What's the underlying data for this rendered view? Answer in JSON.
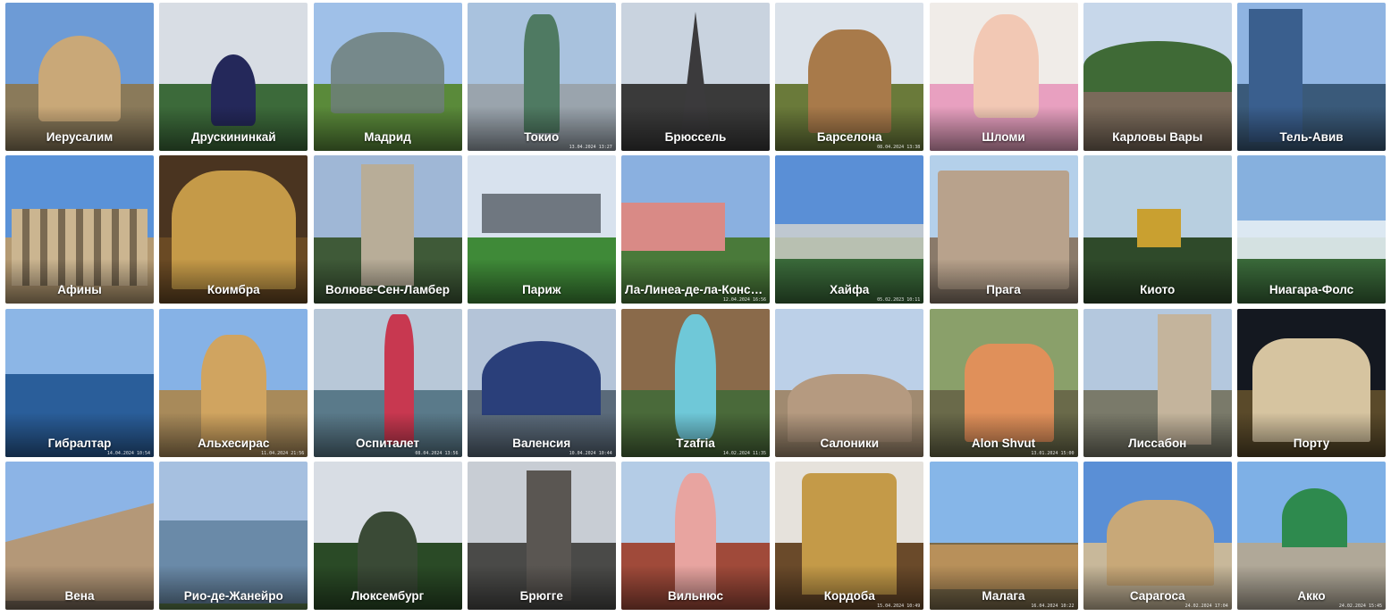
{
  "albums": [
    {
      "label": "Иерусалим",
      "sky": "#6d9bd6",
      "ground": "#8a7a5a",
      "shape": "#c9a878",
      "kind": "dome"
    },
    {
      "label": "Друскининкай",
      "sky": "#d8dde4",
      "ground": "#3c6a3a",
      "shape": "#24285a",
      "kind": "onion"
    },
    {
      "label": "Мадрид",
      "sky": "#9fc0e8",
      "ground": "#5a8a3a",
      "shape": "#6f7f7a",
      "kind": "glass"
    },
    {
      "label": "Токио",
      "sky": "#a9c2de",
      "ground": "#9aa4ad",
      "shape": "#4f7a62",
      "kind": "statue",
      "stamp": "13.04.2024 13:27"
    },
    {
      "label": "Брюссель",
      "sky": "#c9d3df",
      "ground": "#3a3a3a",
      "shape": "#3b3a3c",
      "kind": "spire"
    },
    {
      "label": "Барселона",
      "sky": "#dbe2ea",
      "ground": "#6a7a3a",
      "shape": "#a87a4a",
      "kind": "tower",
      "stamp": "08.04.2024 13:38"
    },
    {
      "label": "Шломи",
      "sky": "#f0ece8",
      "ground": "#e8a0c0",
      "shape": "#f2c8b4",
      "kind": "person"
    },
    {
      "label": "Карловы Вары",
      "sky": "#c7d7ea",
      "ground": "#7a6a5a",
      "shape": "#3f6a36",
      "kind": "town"
    },
    {
      "label": "Тель-Авив",
      "sky": "#8fb4e2",
      "ground": "#3a5a7a",
      "shape": "#3a5f8e",
      "kind": "skyscraper"
    },
    {
      "label": "Афины",
      "sky": "#5a92d8",
      "ground": "#b49a72",
      "shape": "#cbb590",
      "kind": "columns"
    },
    {
      "label": "Коимбра",
      "sky": "#4a3420",
      "ground": "#6a4a24",
      "shape": "#c59a48",
      "kind": "library"
    },
    {
      "label": "Волюве-Сен-Ламбер",
      "sky": "#9fb7d6",
      "ground": "#3f5a38",
      "shape": "#b8ad98",
      "kind": "gothic"
    },
    {
      "label": "Париж",
      "sky": "#d8e2ee",
      "ground": "#3f8a38",
      "shape": "#6f7780",
      "kind": "palace"
    },
    {
      "label": "Ла-Линеа-де-ла-Консепсьон",
      "sky": "#8ab0e0",
      "ground": "#4a7a3a",
      "shape": "#d98a86",
      "kind": "sculpture",
      "stamp": "12.04.2024 16:56"
    },
    {
      "label": "Хайфа",
      "sky": "#5a8fd6",
      "ground": "#3a6a3a",
      "shape": "#d8d6d0",
      "kind": "city",
      "stamp": "05.02.2023 10:11"
    },
    {
      "label": "Прага",
      "sky": "#b4d0ea",
      "ground": "#8a7a6a",
      "shape": "#b8a28c",
      "kind": "station"
    },
    {
      "label": "Киото",
      "sky": "#b8cfe0",
      "ground": "#2f4a2a",
      "shape": "#c9a030",
      "kind": "pavilion"
    },
    {
      "label": "Ниагара-Фолс",
      "sky": "#86b0de",
      "ground": "#3a6a3a",
      "shape": "#e6eef4",
      "kind": "falls"
    },
    {
      "label": "Гибралтар",
      "sky": "#8cb6e6",
      "ground": "#1f4f8a",
      "shape": "#2a5e9a",
      "kind": "sea",
      "stamp": "14.04.2024 10:54"
    },
    {
      "label": "Альхесирас",
      "sky": "#86b2e6",
      "ground": "#a88a5a",
      "shape": "#d0a460",
      "kind": "church",
      "stamp": "11.04.2024 21:56"
    },
    {
      "label": "Оспиталет",
      "sky": "#b8c8d8",
      "ground": "#5a7a8a",
      "shape": "#c83850",
      "kind": "hotel",
      "stamp": "08.04.2024 13:56"
    },
    {
      "label": "Валенсия",
      "sky": "#b4c4d8",
      "ground": "#5a6a7a",
      "shape": "#2a3f7a",
      "kind": "arch",
      "stamp": "10.04.2024 10:44"
    },
    {
      "label": "Tzafria",
      "sky": "#8a6a4a",
      "ground": "#4a6a3a",
      "shape": "#6fc8d8",
      "kind": "figure",
      "stamp": "14.02.2024 11:35"
    },
    {
      "label": "Салоники",
      "sky": "#bcd0e8",
      "ground": "#a08a70",
      "shape": "#b59a80",
      "kind": "basilica"
    },
    {
      "label": "Alon Shvut",
      "sky": "#8aa06a",
      "ground": "#6a6a4a",
      "shape": "#e0905a",
      "kind": "group",
      "stamp": "13.01.2024 15:00"
    },
    {
      "label": "Лиссабон",
      "sky": "#b4c8de",
      "ground": "#7a7a6a",
      "shape": "#c4b49c",
      "kind": "belem"
    },
    {
      "label": "Порту",
      "sky": "#141820",
      "ground": "#5a4a2a",
      "shape": "#d6c4a0",
      "kind": "cityhall"
    },
    {
      "label": "Вена",
      "sky": "#8cb4e6",
      "ground": "#7a6a5a",
      "shape": "#b49878",
      "kind": "cathedral"
    },
    {
      "label": "Рио-де-Жанейро",
      "sky": "#a6c0e0",
      "ground": "#5a7a4a",
      "shape": "#6a8aa8",
      "kind": "bay"
    },
    {
      "label": "Люксембург",
      "sky": "#d8dde4",
      "ground": "#2a4a26",
      "shape": "#3a4a36",
      "kind": "castle"
    },
    {
      "label": "Брюгге",
      "sky": "#c8cdd4",
      "ground": "#4a4a48",
      "shape": "#5a5652",
      "kind": "belfry"
    },
    {
      "label": "Вильнюс",
      "sky": "#b4cce6",
      "ground": "#a04a3a",
      "shape": "#e8a4a0",
      "kind": "redtower"
    },
    {
      "label": "Кордоба",
      "sky": "#e6e2dc",
      "ground": "#6a4a2a",
      "shape": "#c49a48",
      "kind": "organ",
      "stamp": "15.04.2024 10:49"
    },
    {
      "label": "Малага",
      "sky": "#86b6e8",
      "ground": "#7a6a4a",
      "shape": "#b8905a",
      "kind": "fortress",
      "stamp": "16.04.2024 10:22"
    },
    {
      "label": "Сарагоса",
      "sky": "#5a8fd6",
      "ground": "#c8b89a",
      "shape": "#c8a878",
      "kind": "basilica2",
      "stamp": "24.02.2024 17:04"
    },
    {
      "label": "Акко",
      "sky": "#7eb0e6",
      "ground": "#b0a898",
      "shape": "#2e8a4e",
      "kind": "mosque",
      "stamp": "24.02.2024 15:45"
    }
  ]
}
